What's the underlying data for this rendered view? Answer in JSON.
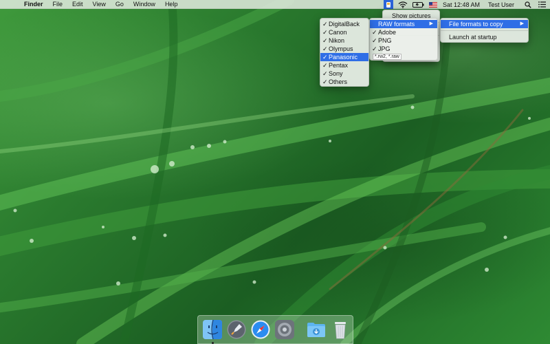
{
  "menubar": {
    "apple_glyph": "",
    "app_name": "Finder",
    "menus": [
      "File",
      "Edit",
      "View",
      "Go",
      "Window",
      "Help"
    ],
    "clock": "Sat 12:48 AM",
    "user": "Test User",
    "status_icons": [
      "photo-importer-status-icon",
      "wifi-icon",
      "battery-icon",
      "us-flag-icon",
      "spotlight-icon",
      "notification-center-icon"
    ]
  },
  "main_menu": {
    "items": [
      {
        "label": "Show pictures"
      },
      {
        "label": "File formats to copy"
      },
      {
        "label": "Launch at startup"
      }
    ]
  },
  "formats_submenu": {
    "items": [
      {
        "label": "RAW formats",
        "checked": false,
        "selected": true,
        "has_submenu": true
      },
      {
        "label": "Adobe",
        "checked": true
      },
      {
        "label": "PNG",
        "checked": true
      },
      {
        "label": "JPG",
        "checked": true
      }
    ],
    "extensions_note": "*.rw2, *.raw"
  },
  "maker_submenu": {
    "items": [
      {
        "label": "DigitalBack",
        "checked": true,
        "selected": false
      },
      {
        "label": "Canon",
        "checked": true,
        "selected": false
      },
      {
        "label": "Nikon",
        "checked": true,
        "selected": false
      },
      {
        "label": "Olympus",
        "checked": true,
        "selected": false
      },
      {
        "label": "Panasonic",
        "checked": true,
        "selected": true
      },
      {
        "label": "Pentax",
        "checked": true,
        "selected": false
      },
      {
        "label": "Sony",
        "checked": true,
        "selected": false
      },
      {
        "label": "Others",
        "checked": true,
        "selected": false
      }
    ]
  },
  "glyphs": {
    "check": "✓",
    "submenu_arrow": "▶"
  },
  "dock": {
    "apps": [
      "finder-icon",
      "launchpad-icon",
      "safari-icon",
      "system-preferences-icon"
    ],
    "others": [
      "downloads-folder-icon",
      "trash-icon"
    ]
  },
  "colors": {
    "selection": "#2f6ee6",
    "menu_background": "#ecf0ea",
    "wallpaper_green": "#2a7a2e"
  }
}
